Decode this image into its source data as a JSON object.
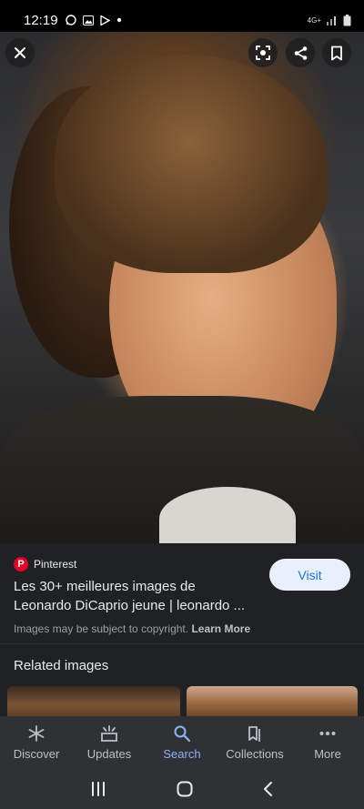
{
  "status_bar": {
    "time": "12:19",
    "icons_left": [
      "whatsapp-icon",
      "gallery-icon",
      "play-store-icon",
      "notification-dot-icon"
    ],
    "network": "4G+",
    "icons_right": [
      "signal-icon",
      "battery-icon"
    ]
  },
  "image_viewer": {
    "close_icon": "close-icon",
    "actions": [
      "lens-icon",
      "share-icon",
      "bookmark-icon"
    ]
  },
  "result": {
    "source": "Pinterest",
    "title_line1": "Les 30+ meilleures images de",
    "title_line2": "Leonardo DiCaprio jeune | leonardo ...",
    "visit_label": "Visit",
    "copyright_text": "Images may be subject to copyright.",
    "learn_more": "Learn More"
  },
  "related": {
    "title": "Related images"
  },
  "bottom_nav": {
    "items": [
      {
        "label": "Discover",
        "icon": "asterisk-icon"
      },
      {
        "label": "Updates",
        "icon": "updates-icon"
      },
      {
        "label": "Search",
        "icon": "search-icon",
        "active": true
      },
      {
        "label": "Collections",
        "icon": "collections-icon"
      },
      {
        "label": "More",
        "icon": "more-icon"
      }
    ]
  },
  "colors": {
    "accent": "#8ab4f8",
    "visit_bg": "#e8f0fe",
    "visit_text": "#1a73e8",
    "pinterest": "#e60023"
  }
}
